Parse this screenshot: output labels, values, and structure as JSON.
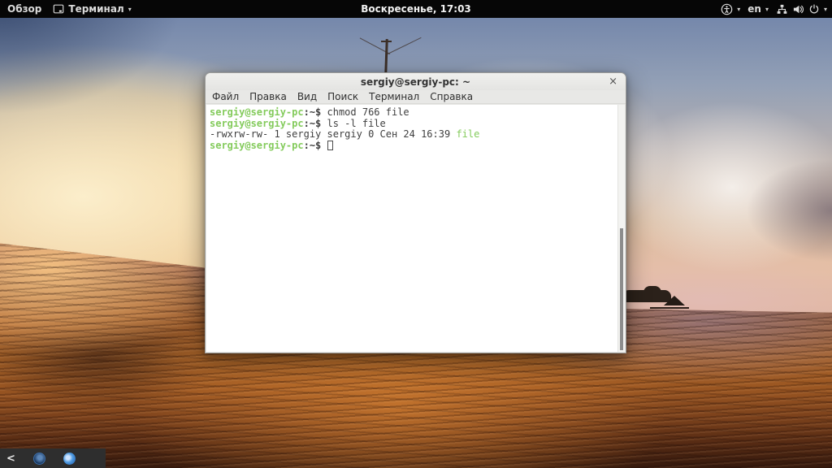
{
  "colors": {
    "prompt_green": "#84cb5c",
    "terminal_foreground": "#3f3f3f",
    "terminal_background": "#ffffff",
    "top_bar_background": "#060606",
    "window_chrome": "#e8e8e6"
  },
  "top_bar": {
    "activities_label": "Обзор",
    "app_menu_label": "Терминал",
    "clock": "Воскресенье, 17:03",
    "language": "en",
    "caret": "▾",
    "icons": [
      "terminal-app-icon",
      "accessibility-icon",
      "network-icon",
      "volume-icon",
      "power-icon"
    ]
  },
  "window": {
    "title": "sergiy@sergiy-pc: ~",
    "close_label": "×",
    "menu": [
      "Файл",
      "Правка",
      "Вид",
      "Поиск",
      "Терминал",
      "Справка"
    ],
    "terminal": {
      "line1": {
        "user": "sergiy@sergiy-pc",
        "sep": ":~$ ",
        "command": "chmod 766 file"
      },
      "line2": {
        "user": "sergiy@sergiy-pc",
        "sep": ":~$ ",
        "command": "ls -l file"
      },
      "line3": {
        "output": "-rwxrw-rw- 1 sergiy sergiy 0 Сен 24 16:39 ",
        "filename": "file"
      },
      "line4": {
        "user": "sergiy@sergiy-pc",
        "sep": ":~$ "
      }
    }
  },
  "tray": {
    "collapse_label": "<"
  }
}
